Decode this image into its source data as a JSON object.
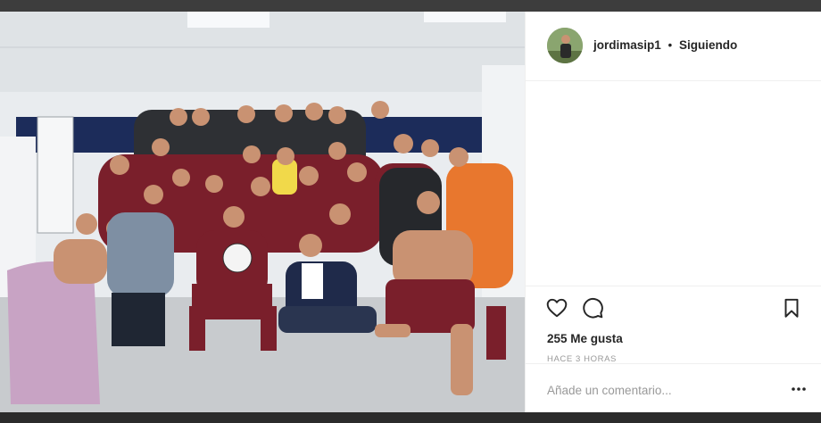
{
  "post": {
    "image_alt": "",
    "username": "jordimasip1",
    "separator": "•",
    "follow_status": "Siguiendo",
    "likes": "255 Me gusta",
    "time_ago": "HACE 3 HORAS",
    "comment_placeholder": "Añade un comentario..."
  },
  "icons": {
    "like": "heart-icon",
    "comment": "comment-icon",
    "save": "bookmark-icon",
    "more": "more-options-icon"
  },
  "colors": {
    "text": "#262626",
    "muted": "#999999",
    "divider": "#efefef",
    "jersey_maroon": "#7a1f2b",
    "keeper_orange": "#e8772e"
  }
}
